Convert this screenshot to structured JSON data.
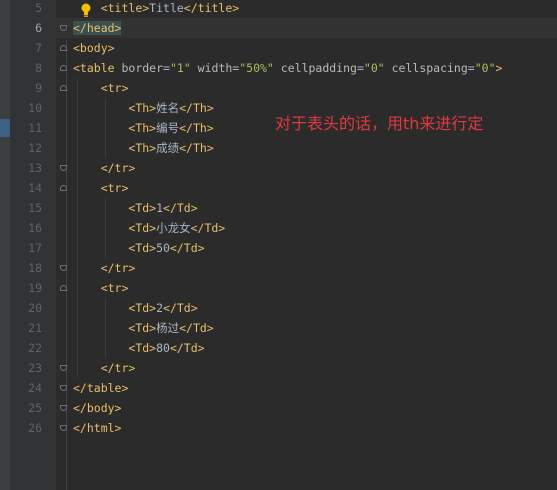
{
  "editor": {
    "current_line": "6",
    "lines": [
      {
        "num": "5",
        "indent": "    ",
        "tokens": [
          {
            "t": "tag",
            "v": "<title>"
          },
          {
            "t": "txt",
            "v": "Title"
          },
          {
            "t": "tag",
            "v": "</title>"
          }
        ]
      },
      {
        "num": "6",
        "indent": "",
        "tokens": [
          {
            "t": "tag",
            "v": "</head>"
          }
        ]
      },
      {
        "num": "7",
        "indent": "",
        "tokens": [
          {
            "t": "tag",
            "v": "<body>"
          }
        ]
      },
      {
        "num": "8",
        "indent": "",
        "tokens": [
          {
            "t": "tag",
            "v": "<table "
          },
          {
            "t": "attr",
            "v": "border"
          },
          {
            "t": "txt",
            "v": "="
          },
          {
            "t": "val",
            "v": "\"1\""
          },
          {
            "t": "txt",
            "v": " "
          },
          {
            "t": "attr",
            "v": "width"
          },
          {
            "t": "txt",
            "v": "="
          },
          {
            "t": "val",
            "v": "\"50%\""
          },
          {
            "t": "txt",
            "v": " "
          },
          {
            "t": "attr",
            "v": "cellpadding"
          },
          {
            "t": "txt",
            "v": "="
          },
          {
            "t": "val",
            "v": "\"0\""
          },
          {
            "t": "txt",
            "v": " "
          },
          {
            "t": "attr",
            "v": "cellspacing"
          },
          {
            "t": "txt",
            "v": "="
          },
          {
            "t": "val",
            "v": "\"0\""
          },
          {
            "t": "tag",
            "v": ">"
          }
        ]
      },
      {
        "num": "9",
        "indent": "    ",
        "tokens": [
          {
            "t": "tag",
            "v": "<tr>"
          }
        ]
      },
      {
        "num": "10",
        "indent": "        ",
        "tokens": [
          {
            "t": "tag",
            "v": "<Th>"
          },
          {
            "t": "txt",
            "v": "姓名"
          },
          {
            "t": "tag",
            "v": "</Th>"
          }
        ]
      },
      {
        "num": "11",
        "indent": "        ",
        "tokens": [
          {
            "t": "tag",
            "v": "<Th>"
          },
          {
            "t": "txt",
            "v": "编号"
          },
          {
            "t": "tag",
            "v": "</Th>"
          }
        ]
      },
      {
        "num": "12",
        "indent": "        ",
        "tokens": [
          {
            "t": "tag",
            "v": "<Th>"
          },
          {
            "t": "txt",
            "v": "成绩"
          },
          {
            "t": "tag",
            "v": "</Th>"
          }
        ]
      },
      {
        "num": "13",
        "indent": "    ",
        "tokens": [
          {
            "t": "tag",
            "v": "</tr>"
          }
        ]
      },
      {
        "num": "14",
        "indent": "    ",
        "tokens": [
          {
            "t": "tag",
            "v": "<tr>"
          }
        ]
      },
      {
        "num": "15",
        "indent": "        ",
        "tokens": [
          {
            "t": "tag",
            "v": "<Td>"
          },
          {
            "t": "txt",
            "v": "1"
          },
          {
            "t": "tag",
            "v": "</Td>"
          }
        ]
      },
      {
        "num": "16",
        "indent": "        ",
        "tokens": [
          {
            "t": "tag",
            "v": "<Td>"
          },
          {
            "t": "txt",
            "v": "小龙女"
          },
          {
            "t": "tag",
            "v": "</Td>"
          }
        ]
      },
      {
        "num": "17",
        "indent": "        ",
        "tokens": [
          {
            "t": "tag",
            "v": "<Td>"
          },
          {
            "t": "txt",
            "v": "50"
          },
          {
            "t": "tag",
            "v": "</Td>"
          }
        ]
      },
      {
        "num": "18",
        "indent": "    ",
        "tokens": [
          {
            "t": "tag",
            "v": "</tr>"
          }
        ]
      },
      {
        "num": "19",
        "indent": "    ",
        "tokens": [
          {
            "t": "tag",
            "v": "<tr>"
          }
        ]
      },
      {
        "num": "20",
        "indent": "        ",
        "tokens": [
          {
            "t": "tag",
            "v": "<Td>"
          },
          {
            "t": "txt",
            "v": "2"
          },
          {
            "t": "tag",
            "v": "</Td>"
          }
        ]
      },
      {
        "num": "21",
        "indent": "        ",
        "tokens": [
          {
            "t": "tag",
            "v": "<Td>"
          },
          {
            "t": "txt",
            "v": "杨过"
          },
          {
            "t": "tag",
            "v": "</Td>"
          }
        ]
      },
      {
        "num": "22",
        "indent": "        ",
        "tokens": [
          {
            "t": "tag",
            "v": "<Td>"
          },
          {
            "t": "txt",
            "v": "80"
          },
          {
            "t": "tag",
            "v": "</Td>"
          }
        ]
      },
      {
        "num": "23",
        "indent": "    ",
        "tokens": [
          {
            "t": "tag",
            "v": "</tr>"
          }
        ]
      },
      {
        "num": "24",
        "indent": "",
        "tokens": [
          {
            "t": "tag",
            "v": "</table>"
          }
        ]
      },
      {
        "num": "25",
        "indent": "",
        "tokens": [
          {
            "t": "tag",
            "v": "</body>"
          }
        ]
      },
      {
        "num": "26",
        "indent": "",
        "tokens": [
          {
            "t": "tag",
            "v": "</html>"
          }
        ]
      }
    ]
  },
  "annotation": "对于表头的话，用th来进行定",
  "icons": {
    "intention_bulb": "lightbulb-icon",
    "fold_marker": "fold-marker-icon"
  },
  "colors": {
    "background": "#2b2b2b",
    "tag": "#e8bf6a",
    "attribute": "#bababa",
    "value": "#a5c25c",
    "text": "#a9b7c6",
    "annotation": "#e0393e"
  }
}
